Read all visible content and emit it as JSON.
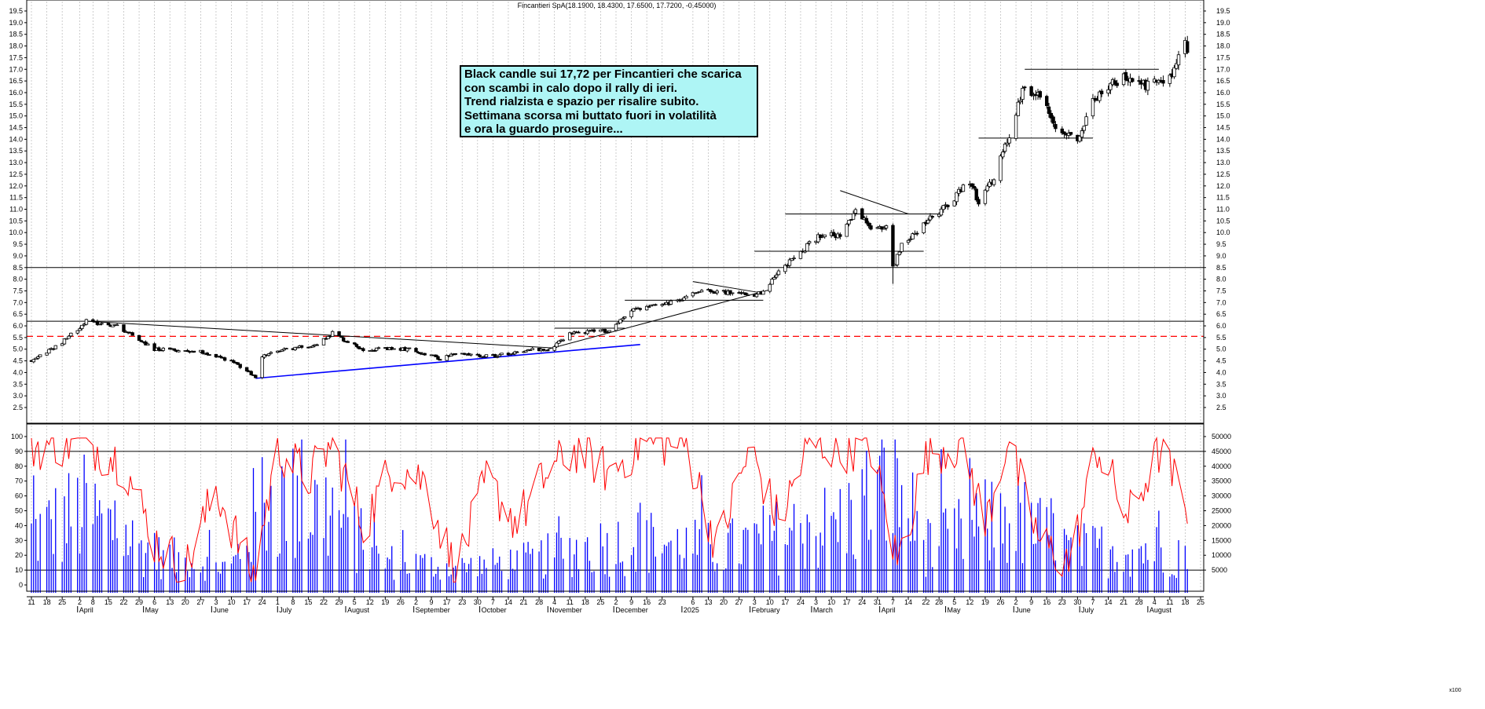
{
  "chart_title": "Fincantieri SpA(18.1900, 18.4300, 17.6500, 17.7200, -0.45000)",
  "annotation_lines": [
    "Black candle sui 17,72 per Fincantieri che scarica",
    "con scambi in calo dopo il rally di ieri.",
    "Trend rialzista e spazio per risalire subito.",
    "Settimana scorsa mi buttato fuori in volatilità",
    "e ora la guardo proseguire..."
  ],
  "volume_axis_label": "x100",
  "colors": {
    "up_candle": "#ffffff",
    "down_candle": "#000000",
    "volume_bars": "#0000ff",
    "oscillator": "#ff0000",
    "support_line": "#0000ff",
    "dashed_level": "#ff0000",
    "annotation_bg": "#aef5f5"
  },
  "chart_data": {
    "type": "candlestick",
    "title": "Fincantieri SpA(18.1900, 18.4300, 17.6500, 17.7200, -0.45000)",
    "last_bar": {
      "open": 18.19,
      "high": 18.43,
      "low": 17.65,
      "close": 17.72,
      "change": -0.45
    },
    "price_axis": {
      "min": 2.5,
      "max": 19.5,
      "step": 0.5
    },
    "oscillator_axis": {
      "ticks": [
        0,
        10,
        20,
        30,
        40,
        50,
        60,
        70,
        80,
        90,
        100
      ],
      "levels": [
        10,
        90
      ]
    },
    "volume_axis": {
      "ticks": [
        5000,
        10000,
        15000,
        20000,
        25000,
        30000,
        35000,
        40000,
        45000,
        50000
      ],
      "unit": "x100"
    },
    "x_start": "2024-03-11",
    "x_end": "2025-08-25",
    "weekly_ticks": [
      {
        "date": "2024-03-11",
        "label": "11"
      },
      {
        "date": "2024-03-18",
        "label": "18"
      },
      {
        "date": "2024-03-25",
        "label": "25"
      },
      {
        "date": "2024-04-02",
        "label": "2"
      },
      {
        "date": "2024-04-08",
        "label": "8"
      },
      {
        "date": "2024-04-15",
        "label": "15"
      },
      {
        "date": "2024-04-22",
        "label": "22"
      },
      {
        "date": "2024-04-29",
        "label": "29"
      },
      {
        "date": "2024-05-06",
        "label": "6"
      },
      {
        "date": "2024-05-13",
        "label": "13"
      },
      {
        "date": "2024-05-20",
        "label": "20"
      },
      {
        "date": "2024-05-27",
        "label": "27"
      },
      {
        "date": "2024-06-03",
        "label": "3"
      },
      {
        "date": "2024-06-10",
        "label": "10"
      },
      {
        "date": "2024-06-17",
        "label": "17"
      },
      {
        "date": "2024-06-24",
        "label": "24"
      },
      {
        "date": "2024-07-01",
        "label": "1"
      },
      {
        "date": "2024-07-08",
        "label": "8"
      },
      {
        "date": "2024-07-15",
        "label": "15"
      },
      {
        "date": "2024-07-22",
        "label": "22"
      },
      {
        "date": "2024-07-29",
        "label": "29"
      },
      {
        "date": "2024-08-05",
        "label": "5"
      },
      {
        "date": "2024-08-12",
        "label": "12"
      },
      {
        "date": "2024-08-19",
        "label": "19"
      },
      {
        "date": "2024-08-26",
        "label": "26"
      },
      {
        "date": "2024-09-02",
        "label": "2"
      },
      {
        "date": "2024-09-09",
        "label": "9"
      },
      {
        "date": "2024-09-16",
        "label": "17"
      },
      {
        "date": "2024-09-23",
        "label": "23"
      },
      {
        "date": "2024-09-30",
        "label": "30"
      },
      {
        "date": "2024-10-07",
        "label": "7"
      },
      {
        "date": "2024-10-14",
        "label": "14"
      },
      {
        "date": "2024-10-21",
        "label": "21"
      },
      {
        "date": "2024-10-28",
        "label": "28"
      },
      {
        "date": "2024-11-04",
        "label": "4"
      },
      {
        "date": "2024-11-11",
        "label": "11"
      },
      {
        "date": "2024-11-18",
        "label": "18"
      },
      {
        "date": "2024-11-25",
        "label": "25"
      },
      {
        "date": "2024-12-02",
        "label": "2"
      },
      {
        "date": "2024-12-09",
        "label": "9"
      },
      {
        "date": "2024-12-16",
        "label": "16"
      },
      {
        "date": "2024-12-23",
        "label": "23"
      },
      {
        "date": "2025-01-06",
        "label": "6"
      },
      {
        "date": "2025-01-13",
        "label": "13"
      },
      {
        "date": "2025-01-20",
        "label": "20"
      },
      {
        "date": "2025-01-27",
        "label": "27"
      },
      {
        "date": "2025-02-03",
        "label": "3"
      },
      {
        "date": "2025-02-10",
        "label": "10"
      },
      {
        "date": "2025-02-17",
        "label": "17"
      },
      {
        "date": "2025-02-24",
        "label": "24"
      },
      {
        "date": "2025-03-03",
        "label": "3"
      },
      {
        "date": "2025-03-10",
        "label": "10"
      },
      {
        "date": "2025-03-17",
        "label": "17"
      },
      {
        "date": "2025-03-24",
        "label": "24"
      },
      {
        "date": "2025-03-31",
        "label": "31"
      },
      {
        "date": "2025-04-07",
        "label": "7"
      },
      {
        "date": "2025-04-14",
        "label": "14"
      },
      {
        "date": "2025-04-22",
        "label": "22"
      },
      {
        "date": "2025-04-28",
        "label": "28"
      },
      {
        "date": "2025-05-05",
        "label": "5"
      },
      {
        "date": "2025-05-12",
        "label": "12"
      },
      {
        "date": "2025-05-19",
        "label": "19"
      },
      {
        "date": "2025-05-26",
        "label": "26"
      },
      {
        "date": "2025-06-02",
        "label": "2"
      },
      {
        "date": "2025-06-09",
        "label": "9"
      },
      {
        "date": "2025-06-16",
        "label": "16"
      },
      {
        "date": "2025-06-23",
        "label": "23"
      },
      {
        "date": "2025-06-30",
        "label": "30"
      },
      {
        "date": "2025-07-07",
        "label": "7"
      },
      {
        "date": "2025-07-14",
        "label": "14"
      },
      {
        "date": "2025-07-21",
        "label": "21"
      },
      {
        "date": "2025-07-28",
        "label": "28"
      },
      {
        "date": "2025-08-04",
        "label": "4"
      },
      {
        "date": "2025-08-11",
        "label": "11"
      },
      {
        "date": "2025-08-18",
        "label": "18"
      },
      {
        "date": "2025-08-25",
        "label": "25"
      }
    ],
    "month_labels": [
      {
        "date": "2024-04-01",
        "label": "April"
      },
      {
        "date": "2024-05-01",
        "label": "May"
      },
      {
        "date": "2024-06-01",
        "label": "June"
      },
      {
        "date": "2024-07-01",
        "label": "July"
      },
      {
        "date": "2024-08-01",
        "label": "August"
      },
      {
        "date": "2024-09-01",
        "label": "September"
      },
      {
        "date": "2024-10-01",
        "label": "October"
      },
      {
        "date": "2024-11-01",
        "label": "November"
      },
      {
        "date": "2024-12-01",
        "label": "December"
      },
      {
        "date": "2025-01-01",
        "label": "2025"
      },
      {
        "date": "2025-02-01",
        "label": "February"
      },
      {
        "date": "2025-03-01",
        "label": "March"
      },
      {
        "date": "2025-04-01",
        "label": "April"
      },
      {
        "date": "2025-05-01",
        "label": "May"
      },
      {
        "date": "2025-06-01",
        "label": "June"
      },
      {
        "date": "2025-07-01",
        "label": "July"
      },
      {
        "date": "2025-08-01",
        "label": "August"
      }
    ],
    "price_anchors": [
      [
        "2024-03-11",
        4.5
      ],
      [
        "2024-03-25",
        5.3
      ],
      [
        "2024-04-05",
        6.2
      ],
      [
        "2024-04-19",
        6.0
      ],
      [
        "2024-04-26",
        5.6
      ],
      [
        "2024-05-06",
        5.0
      ],
      [
        "2024-05-27",
        4.9
      ],
      [
        "2024-06-10",
        4.5
      ],
      [
        "2024-06-21",
        3.8
      ],
      [
        "2024-06-24",
        4.7
      ],
      [
        "2024-07-05",
        5.0
      ],
      [
        "2024-07-19",
        5.2
      ],
      [
        "2024-07-26",
        5.7
      ],
      [
        "2024-08-02",
        5.3
      ],
      [
        "2024-08-09",
        5.0
      ],
      [
        "2024-08-30",
        5.0
      ],
      [
        "2024-09-13",
        4.6
      ],
      [
        "2024-09-20",
        4.8
      ],
      [
        "2024-10-07",
        4.7
      ],
      [
        "2024-10-25",
        5.0
      ],
      [
        "2024-11-01",
        4.9
      ],
      [
        "2024-11-11",
        5.7
      ],
      [
        "2024-11-29",
        5.8
      ],
      [
        "2024-12-09",
        6.7
      ],
      [
        "2024-12-23",
        6.9
      ],
      [
        "2024-12-31",
        7.1
      ],
      [
        "2025-01-10",
        7.6
      ],
      [
        "2025-01-24",
        7.4
      ],
      [
        "2025-01-31",
        7.3
      ],
      [
        "2025-02-07",
        7.4
      ],
      [
        "2025-02-14",
        8.3
      ],
      [
        "2025-02-28",
        9.5
      ],
      [
        "2025-03-07",
        10.0
      ],
      [
        "2025-03-14",
        9.8
      ],
      [
        "2025-03-21",
        10.9
      ],
      [
        "2025-03-28",
        10.2
      ],
      [
        "2025-04-04",
        10.3
      ],
      [
        "2025-04-07",
        8.5
      ],
      [
        "2025-04-11",
        9.5
      ],
      [
        "2025-04-23",
        10.5
      ],
      [
        "2025-05-05",
        11.5
      ],
      [
        "2025-05-12",
        12.2
      ],
      [
        "2025-05-16",
        11.3
      ],
      [
        "2025-05-23",
        12.3
      ],
      [
        "2025-05-30",
        14.2
      ],
      [
        "2025-06-06",
        16.3
      ],
      [
        "2025-06-13",
        15.8
      ],
      [
        "2025-06-20",
        14.6
      ],
      [
        "2025-06-30",
        14.0
      ],
      [
        "2025-07-07",
        15.6
      ],
      [
        "2025-07-14",
        16.3
      ],
      [
        "2025-07-21",
        16.6
      ],
      [
        "2025-07-31",
        16.3
      ],
      [
        "2025-08-08",
        16.5
      ],
      [
        "2025-08-13",
        17.0
      ],
      [
        "2025-08-18",
        18.17
      ],
      [
        "2025-08-19",
        17.72
      ]
    ],
    "oscillator_anchors": [
      [
        "2024-03-11",
        93
      ],
      [
        "2024-04-04",
        97
      ],
      [
        "2024-04-22",
        82
      ],
      [
        "2024-05-06",
        30
      ],
      [
        "2024-05-20",
        10
      ],
      [
        "2024-06-03",
        65
      ],
      [
        "2024-06-20",
        5
      ],
      [
        "2024-07-01",
        92
      ],
      [
        "2024-07-15",
        72
      ],
      [
        "2024-07-26",
        95
      ],
      [
        "2024-08-09",
        40
      ],
      [
        "2024-08-23",
        82
      ],
      [
        "2024-09-06",
        70
      ],
      [
        "2024-09-20",
        8
      ],
      [
        "2024-10-04",
        70
      ],
      [
        "2024-10-18",
        42
      ],
      [
        "2024-11-01",
        76
      ],
      [
        "2024-11-15",
        92
      ],
      [
        "2024-11-29",
        75
      ],
      [
        "2024-12-13",
        96
      ],
      [
        "2025-01-03",
        95
      ],
      [
        "2025-01-17",
        25
      ],
      [
        "2025-02-01",
        92
      ],
      [
        "2025-02-14",
        42
      ],
      [
        "2025-02-28",
        95
      ],
      [
        "2025-03-14",
        92
      ],
      [
        "2025-03-28",
        93
      ],
      [
        "2025-04-09",
        15
      ],
      [
        "2025-04-23",
        90
      ],
      [
        "2025-05-09",
        95
      ],
      [
        "2025-05-19",
        40
      ],
      [
        "2025-05-29",
        97
      ],
      [
        "2025-06-13",
        28
      ],
      [
        "2025-06-27",
        15
      ],
      [
        "2025-07-09",
        93
      ],
      [
        "2025-07-23",
        45
      ],
      [
        "2025-08-06",
        90
      ],
      [
        "2025-08-19",
        55
      ]
    ],
    "volume_anchors": [
      [
        "2024-03-11",
        20000
      ],
      [
        "2024-04-04",
        30000
      ],
      [
        "2024-05-06",
        12000
      ],
      [
        "2024-06-10",
        7000
      ],
      [
        "2024-06-24",
        35000
      ],
      [
        "2024-07-26",
        30000
      ],
      [
        "2024-08-16",
        10000
      ],
      [
        "2024-09-20",
        7000
      ],
      [
        "2024-10-25",
        10000
      ],
      [
        "2024-11-15",
        15000
      ],
      [
        "2024-12-13",
        18000
      ],
      [
        "2025-01-17",
        14000
      ],
      [
        "2025-02-14",
        20000
      ],
      [
        "2025-03-14",
        25000
      ],
      [
        "2025-04-07",
        42000
      ],
      [
        "2025-04-23",
        15000
      ],
      [
        "2025-05-30",
        28000
      ],
      [
        "2025-06-27",
        14000
      ],
      [
        "2025-07-23",
        15000
      ],
      [
        "2025-08-19",
        14000
      ]
    ],
    "horizontal_levels": [
      {
        "price": 8.5,
        "style": "solid",
        "color": "#000000"
      },
      {
        "price": 6.2,
        "style": "solid",
        "color": "#000000"
      },
      {
        "price": 5.55,
        "style": "dashed",
        "color": "#ff0000"
      }
    ],
    "trendlines": [
      {
        "from": [
          "2024-04-05",
          6.2
        ],
        "to": [
          "2024-11-04",
          5.05
        ],
        "color": "#000000"
      },
      {
        "from": [
          "2024-06-21",
          3.75
        ],
        "to": [
          "2024-12-13",
          5.2
        ],
        "color": "#0000ff"
      },
      {
        "from": [
          "2024-11-01",
          5.0
        ],
        "to": [
          "2025-02-10",
          7.55
        ],
        "color": "#000000"
      },
      {
        "from": [
          "2024-11-04",
          5.9
        ],
        "to": [
          "2024-12-06",
          5.9
        ],
        "color": "#000000"
      },
      {
        "from": [
          "2024-12-06",
          7.1
        ],
        "to": [
          "2025-02-07",
          7.1
        ],
        "color": "#000000"
      },
      {
        "from": [
          "2025-01-06",
          7.9
        ],
        "to": [
          "2025-02-07",
          7.4
        ],
        "color": "#000000"
      },
      {
        "from": [
          "2025-02-03",
          9.2
        ],
        "to": [
          "2025-04-21",
          9.2
        ],
        "color": "#000000"
      },
      {
        "from": [
          "2025-02-17",
          10.8
        ],
        "to": [
          "2025-04-28",
          10.8
        ],
        "color": "#000000"
      },
      {
        "from": [
          "2025-03-14",
          11.8
        ],
        "to": [
          "2025-04-14",
          10.8
        ],
        "color": "#000000"
      },
      {
        "from": [
          "2025-05-16",
          14.05
        ],
        "to": [
          "2025-07-07",
          14.05
        ],
        "color": "#000000"
      },
      {
        "from": [
          "2025-06-06",
          17.0
        ],
        "to": [
          "2025-08-06",
          17.0
        ],
        "color": "#000000"
      }
    ]
  }
}
